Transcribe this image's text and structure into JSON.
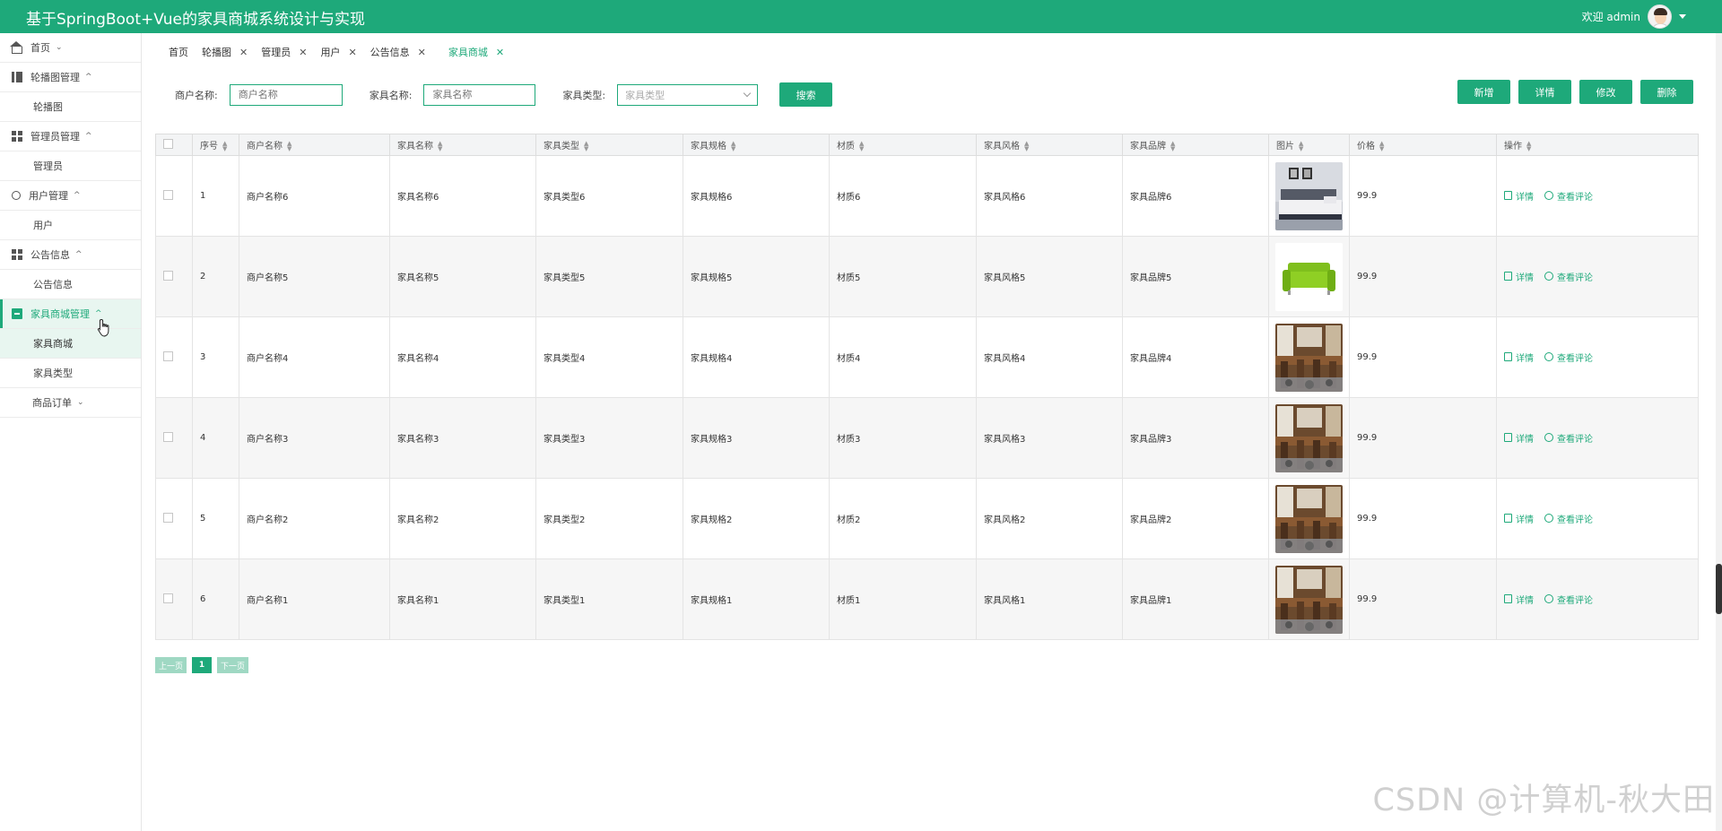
{
  "app": {
    "title": "基于SpringBoot+Vue的家具商城系统设计与实现",
    "welcome": "欢迎 admin"
  },
  "sidebar": {
    "items": [
      {
        "label": "首页",
        "icon": "home-icon",
        "chevron": "⌄",
        "children": []
      },
      {
        "label": "轮播图管理",
        "icon": "bars-icon",
        "chevron": "^",
        "children": [
          "轮播图"
        ]
      },
      {
        "label": "管理员管理",
        "icon": "grid-icon",
        "chevron": "^",
        "children": [
          "管理员"
        ]
      },
      {
        "label": "用户管理",
        "icon": "user-icon",
        "chevron": "^",
        "children": [
          "用户"
        ]
      },
      {
        "label": "公告信息",
        "icon": "grid-icon",
        "chevron": "^",
        "children": [
          "公告信息"
        ]
      },
      {
        "label": "家具商城管理",
        "icon": "box-icon",
        "chevron": "^",
        "children": [
          "家具商城",
          "家具类型"
        ]
      },
      {
        "label": "商品订单",
        "icon": "",
        "chevron": "⌄",
        "children": []
      }
    ]
  },
  "tabs": [
    "首页",
    "轮播图",
    "管理员",
    "用户",
    "公告信息",
    "家具商城"
  ],
  "search": {
    "merchant_label": "商户名称:",
    "merchant_placeholder": "商户名称",
    "name_label": "家具名称:",
    "name_placeholder": "家具名称",
    "type_label": "家具类型:",
    "type_placeholder": "家具类型",
    "search_button": "搜索"
  },
  "actions": {
    "add": "新增",
    "detail": "详情",
    "edit": "修改",
    "delete": "删除"
  },
  "table": {
    "headers": [
      "序号",
      "商户名称",
      "家具名称",
      "家具类型",
      "家具规格",
      "材质",
      "家具风格",
      "家具品牌",
      "图片",
      "价格",
      "操作"
    ],
    "rows": [
      {
        "no": "1",
        "merchant": "商户名称6",
        "name": "家具名称6",
        "type": "家具类型6",
        "spec": "家具规格6",
        "material": "材质6",
        "style": "家具风格6",
        "brand": "家具品牌6",
        "image": "bedroom",
        "price": "99.9"
      },
      {
        "no": "2",
        "merchant": "商户名称5",
        "name": "家具名称5",
        "type": "家具类型5",
        "spec": "家具规格5",
        "material": "材质5",
        "style": "家具风格5",
        "brand": "家具品牌5",
        "image": "sofa",
        "price": "99.9"
      },
      {
        "no": "3",
        "merchant": "商户名称4",
        "name": "家具名称4",
        "type": "家具类型4",
        "spec": "家具规格4",
        "material": "材质4",
        "style": "家具风格4",
        "brand": "家具品牌4",
        "image": "dining",
        "price": "99.9"
      },
      {
        "no": "4",
        "merchant": "商户名称3",
        "name": "家具名称3",
        "type": "家具类型3",
        "spec": "家具规格3",
        "material": "材质3",
        "style": "家具风格3",
        "brand": "家具品牌3",
        "image": "dining",
        "price": "99.9"
      },
      {
        "no": "5",
        "merchant": "商户名称2",
        "name": "家具名称2",
        "type": "家具类型2",
        "spec": "家具规格2",
        "material": "材质2",
        "style": "家具风格2",
        "brand": "家具品牌2",
        "image": "dining",
        "price": "99.9"
      },
      {
        "no": "6",
        "merchant": "商户名称1",
        "name": "家具名称1",
        "type": "家具类型1",
        "spec": "家具规格1",
        "material": "材质1",
        "style": "家具风格1",
        "brand": "家具品牌1",
        "image": "dining",
        "price": "99.9"
      }
    ],
    "op_detail": "详情",
    "op_review": "查看评论"
  },
  "pager": {
    "prev": "上一页",
    "current": "1",
    "next": "下一页"
  },
  "watermark": "CSDN @计算机-秋大田",
  "colors": {
    "accent": "#1ea97a",
    "accent_light": "#e8f6f0"
  }
}
